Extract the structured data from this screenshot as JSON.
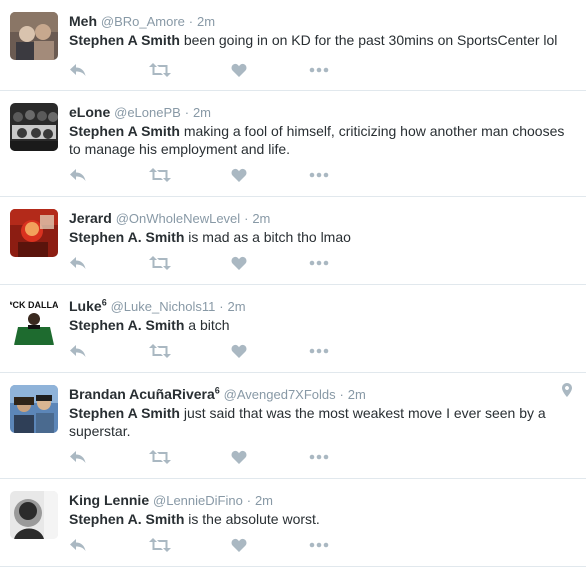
{
  "tweets": [
    {
      "name": "Meh",
      "name_sup": "",
      "handle": "@BRo_Amore",
      "dot": "·",
      "time": "2m",
      "mention": "Stephen A Smith",
      "text": " been going in on KD for the past 30mins on SportsCenter lol",
      "avatar_colors": [
        "#6b5b52",
        "#a38b7a",
        "#d9c3ae"
      ]
    },
    {
      "name": "eLone",
      "name_sup": "",
      "handle": "@eLonePB",
      "dot": "·",
      "time": "2m",
      "mention": "Stephen A Smith",
      "text": " making a fool of himself, criticizing how another man chooses to manage his employment and life.",
      "avatar_colors": [
        "#2a2a2a",
        "#5a5a5a",
        "#c9c9c9"
      ]
    },
    {
      "name": "Jerard",
      "name_sup": "",
      "handle": "@OnWholeNewLevel",
      "dot": "·",
      "time": "2m",
      "mention": "Stephen A. Smith",
      "text": " is mad as a bitch tho lmao",
      "avatar_colors": [
        "#8c1d12",
        "#d9321f",
        "#f2a25c"
      ]
    },
    {
      "name": "Luke",
      "name_sup": "6",
      "handle": "@Luke_Nichols11",
      "dot": "·",
      "time": "2m",
      "mention": "Stephen A. Smith",
      "text": " a bitch",
      "avatar_colors": [
        "#ffffff",
        "#1e6b2f",
        "#111111"
      ],
      "avatar_text": "F*CK DALLAS"
    },
    {
      "name": "Brandan AcuñaRivera",
      "name_sup": "6",
      "handle": "@Avenged7XFolds",
      "dot": "·",
      "time": "2m",
      "mention": "Stephen A Smith",
      "text": " just said that was the most weakest move I ever seen by a superstar.",
      "avatar_colors": [
        "#5c86b8",
        "#c9a27e",
        "#2f3f57"
      ]
    },
    {
      "name": "King Lennie",
      "name_sup": "",
      "handle": "@LennieDiFino",
      "dot": "·",
      "time": "2m",
      "mention": "Stephen A. Smith",
      "text": " is the absolute worst.",
      "avatar_colors": [
        "#2b2b2b",
        "#9a9a9a",
        "#e8e8e8"
      ]
    }
  ],
  "icons": {
    "reply": "reply-icon",
    "retweet": "retweet-icon",
    "like": "heart-icon",
    "more": "more-icon",
    "geo": "location-pin-icon"
  },
  "colors": {
    "name": "#292f33",
    "meta": "#8899a6",
    "action_icon": "#aab8c2",
    "divider": "#e1e8ed"
  }
}
